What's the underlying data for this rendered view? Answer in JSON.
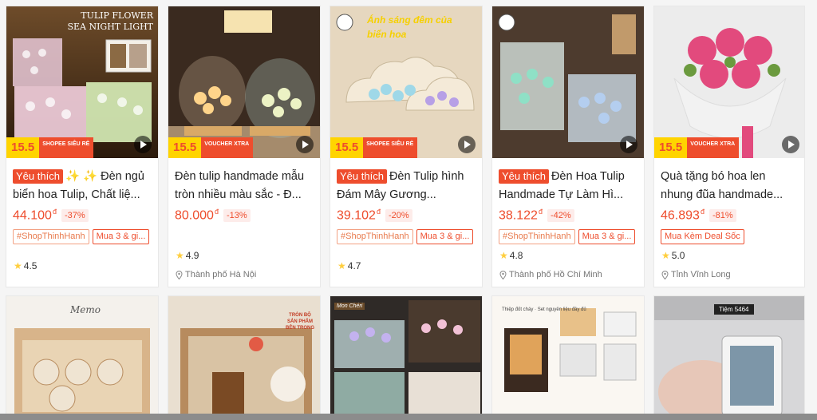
{
  "products": [
    {
      "favorite": "Yêu thích",
      "title": "✨ ✨ Đèn ngủ biển hoa Tulip, Chất liệ...",
      "price": "44.100",
      "currency": "đ",
      "discount": "-37%",
      "tags": [
        "#ShopThinhHanh",
        "Mua 3 & gi..."
      ],
      "rating": "4.5",
      "location": "",
      "promo_big": "15.5",
      "promo_small": "SHOPEE SIÊU RẺ",
      "overlay_text": "TULIP FLOWER SEA NIGHT LIGHT"
    },
    {
      "favorite": "",
      "title": "Đèn tulip handmade mẫu tròn nhiều màu sắc - Đ...",
      "price": "80.000",
      "currency": "đ",
      "discount": "-13%",
      "tags": [],
      "rating": "4.9",
      "location": "Thành phố Hà Nội",
      "promo_big": "15.5",
      "promo_small": "VOUCHER XTRA",
      "overlay_text": ""
    },
    {
      "favorite": "Yêu thích",
      "title": "Đèn Tulip hình Đám Mây Gương...",
      "price": "39.102",
      "currency": "đ",
      "discount": "-20%",
      "tags": [
        "#ShopThinhHanh",
        "Mua 3 & gi..."
      ],
      "rating": "4.7",
      "location": "",
      "promo_big": "15.5",
      "promo_small": "SHOPEE SIÊU RẺ",
      "overlay_text": "Ánh sáng đêm của biển hoa"
    },
    {
      "favorite": "Yêu thích",
      "title": "Đèn Hoa Tulip Handmade Tự Làm Hì...",
      "price": "38.122",
      "currency": "đ",
      "discount": "-42%",
      "tags": [
        "#ShopThinhHanh",
        "Mua 3 & gi..."
      ],
      "rating": "4.8",
      "location": "Thành phố Hồ Chí Minh",
      "promo_big": "",
      "promo_small": "",
      "overlay_text": ""
    },
    {
      "favorite": "",
      "title": "Quà tặng bó hoa len nhung đũa handmade...",
      "price": "46.893",
      "currency": "đ",
      "discount": "-81%",
      "tags": [
        "Mua Kèm Deal Sốc"
      ],
      "rating": "5.0",
      "location": "Tỉnh Vĩnh Long",
      "promo_big": "15.5",
      "promo_small": "VOUCHER XTRA",
      "overlay_text": ""
    }
  ],
  "row2": [
    {
      "overlay_text": "Memo"
    },
    {
      "overlay_text": "TRÒN BỘ SẢN PHẨM BÊN TRONG"
    },
    {
      "overlay_text": "Mon Chéri"
    },
    {
      "overlay_text": "Thiệp đốt cháy · Set nguyên liệu đầy đủ"
    },
    {
      "overlay_text": "Tiệm 5464"
    }
  ],
  "colors": {
    "accent": "#ee4d2d",
    "star": "#ffce3d",
    "promo_yellow": "#ffd400"
  }
}
